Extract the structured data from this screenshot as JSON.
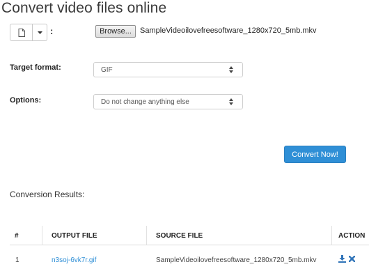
{
  "page": {
    "title": "Convert video files online"
  },
  "source": {
    "colon": ":",
    "browse_label": "Browse...",
    "filename": "SampleVideoilovefreesoftware_1280x720_5mb.mkv"
  },
  "form": {
    "target_format": {
      "label": "Target format:",
      "value": "GIF"
    },
    "options": {
      "label": "Options:",
      "value": "Do not change anything else"
    }
  },
  "convert_button": "Convert Now!",
  "results": {
    "title": "Conversion Results:",
    "headers": {
      "num": "#",
      "output": "OUTPUT FILE",
      "source": "SOURCE FILE",
      "action": "ACTION"
    },
    "rows": [
      {
        "num": "1",
        "output": "n3soj-6vk7r.gif",
        "source": "SampleVideoilovefreesoftware_1280x720_5mb.mkv",
        "actions": [
          "download-icon",
          "delete-icon"
        ]
      }
    ]
  },
  "colors": {
    "accent": "#2f8fd6",
    "text": "#333333"
  }
}
